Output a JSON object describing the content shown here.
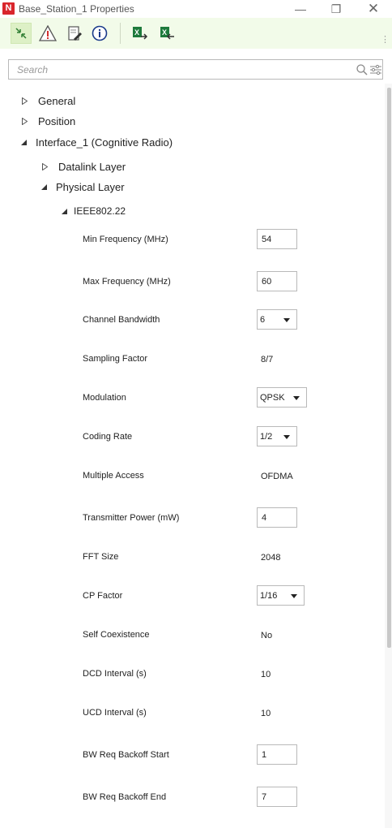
{
  "window": {
    "title": "Base_Station_1 Properties",
    "logo_letter": "N",
    "controls": {
      "minimize": "—",
      "maximize": "❐",
      "close": "✕"
    }
  },
  "toolbar": {
    "buttons": [
      {
        "name": "collapse-all-icon"
      },
      {
        "name": "warning-icon"
      },
      {
        "name": "edit-document-icon"
      },
      {
        "name": "info-icon"
      },
      {
        "name": "export-excel-icon"
      },
      {
        "name": "import-excel-icon"
      }
    ]
  },
  "search": {
    "placeholder": "Search"
  },
  "tree": {
    "general": "General",
    "position": "Position",
    "interface": "Interface_1 (Cognitive Radio)",
    "datalink": "Datalink Layer",
    "physical": "Physical Layer",
    "standard": "IEEE802.22"
  },
  "properties": {
    "min_frequency": {
      "label": "Min Frequency (MHz)",
      "value": "54"
    },
    "max_frequency": {
      "label": "Max Frequency (MHz)",
      "value": "60"
    },
    "channel_bandwidth": {
      "label": "Channel Bandwidth",
      "value": "6"
    },
    "sampling_factor": {
      "label": "Sampling Factor",
      "value": "8/7"
    },
    "modulation": {
      "label": "Modulation",
      "value": "QPSK"
    },
    "coding_rate": {
      "label": "Coding Rate",
      "value": "1/2"
    },
    "multiple_access": {
      "label": "Multiple Access",
      "value": "OFDMA"
    },
    "transmitter_power": {
      "label": "Transmitter Power (mW)",
      "value": "4"
    },
    "fft_size": {
      "label": "FFT Size",
      "value": "2048"
    },
    "cp_factor": {
      "label": "CP Factor",
      "value": "1/16"
    },
    "self_coexistence": {
      "label": "Self Coexistence",
      "value": "No"
    },
    "dcd_interval": {
      "label": "DCD Interval (s)",
      "value": "10"
    },
    "ucd_interval": {
      "label": "UCD Interval (s)",
      "value": "10"
    },
    "bw_req_backoff_start": {
      "label": "BW Req Backoff Start",
      "value": "1"
    },
    "bw_req_backoff_end": {
      "label": "BW Req Backoff End",
      "value": "7"
    }
  },
  "colors": {
    "toolbar_bg": "#f2fbe9",
    "logo_red": "#d9262c",
    "excel_green": "#1e7a3c"
  }
}
